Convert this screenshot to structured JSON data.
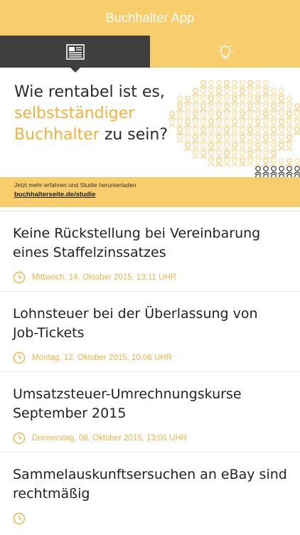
{
  "app": {
    "title": "Buchhalter App"
  },
  "tabs": [
    {
      "icon": "newspaper-icon",
      "active": true
    },
    {
      "icon": "lightbulb-icon",
      "active": false
    }
  ],
  "colors": {
    "accent": "#f8cd6c",
    "dark_tab": "#3f3f3f",
    "highlight": "#f2b23a",
    "date": "#f0b44a"
  },
  "banner": {
    "headline_1": "Wie rentabel ist es,",
    "headline_2": "selbstständiger",
    "headline_3a": "Buchhalter",
    "headline_3b": " zu sein?",
    "cta_text": "Jetzt mehr erfahren und Studie herunterladen",
    "cta_link": "buchhalterseite.de/studie"
  },
  "news": [
    {
      "title": "Keine Rückstellung bei Vereinbarung eines Staffelzinssatzes",
      "date": "Mittwoch, 14. Oktober 2015, 13:11 UHR"
    },
    {
      "title": "Lohnsteuer bei der Überlassung von Job-Tickets",
      "date": "Montag, 12. Oktober 2015, 10:06 UHR"
    },
    {
      "title": "Umsatzsteuer-Umrechnungskurse September 2015",
      "date": "Donnerstag, 08. Oktober 2015, 13:05 UHR"
    },
    {
      "title": "Sammelauskunftsersuchen an eBay sind rechtmäßig",
      "date": ""
    }
  ]
}
